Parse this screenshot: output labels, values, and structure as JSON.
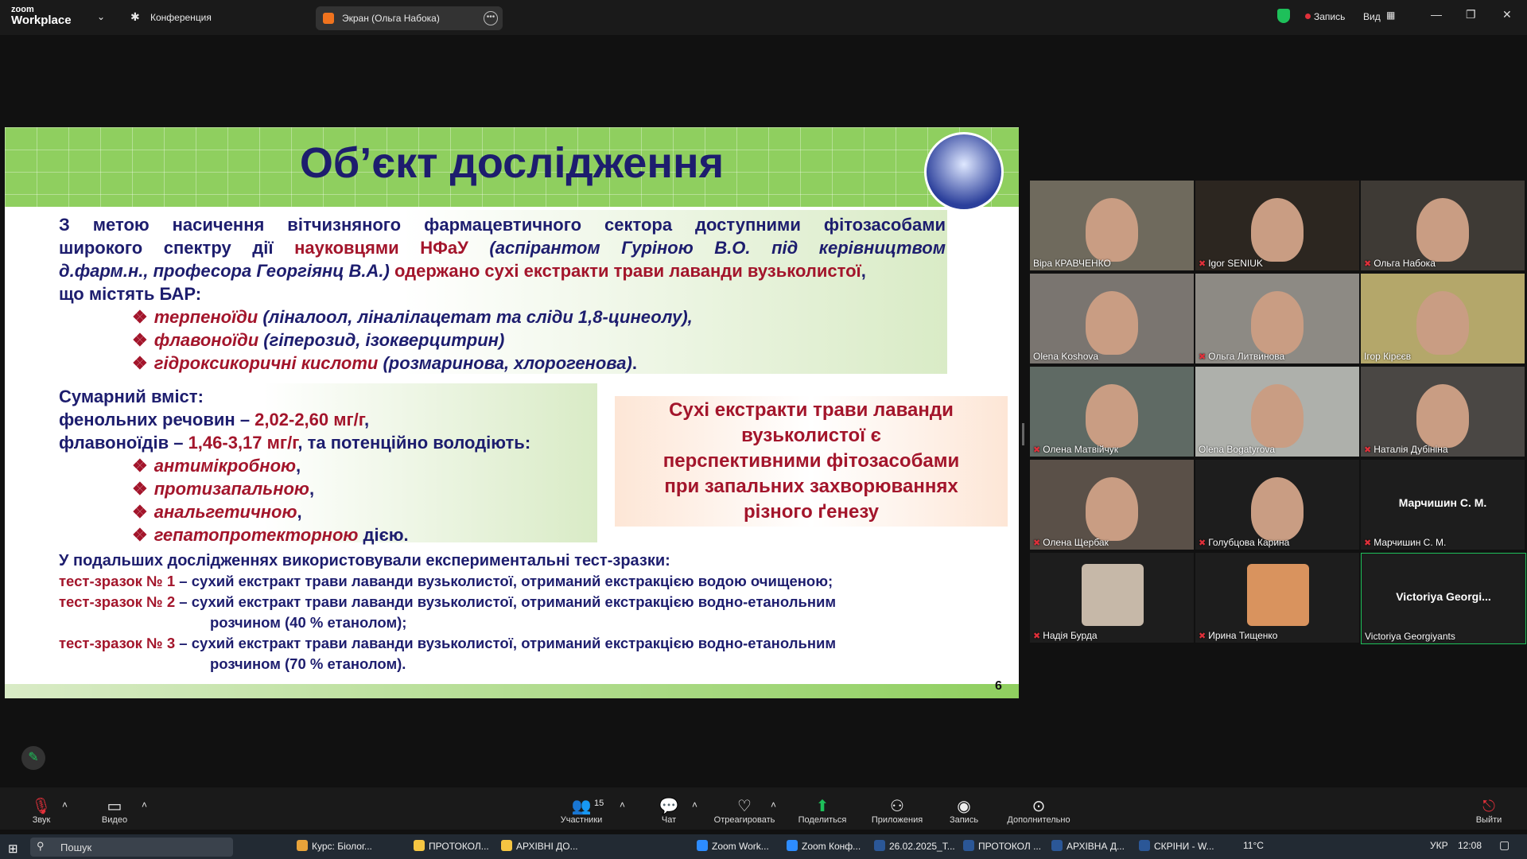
{
  "app": {
    "brand_line1": "zoom",
    "brand_line2": "Workplace",
    "conference": "Конференция",
    "sharing": "Экран (Ольга Набока)",
    "record_status": "Запись",
    "view": "Вид"
  },
  "slide": {
    "title": "Об’єкт дослідження",
    "p1_a": "З метою насичення вітчизняного фармацевтичного сектора доступними фітозасобами",
    "p1_b1": "широкого спектру дії ",
    "p1_b2": "науковцями НФаУ",
    "p1_b3": " (аспірантом Гуріною В.О. під керівництвом",
    "p1_c1": "д.фарм.н., професора Георгіянц В.А.)",
    "p1_c2": " одержано сухі екстракти трави лаванди вузьколистої",
    "p1_c3": ",",
    "p1_d": "що містять БАР:",
    "b1_a": "терпеноїди",
    "b1_b": " (ліналоол, ліналілацетат та сліди 1,8-цинеолу),",
    "b2_a": "флавоноїди",
    "b2_b": " (гіперозид, ізокверцитрин)",
    "b3_a": "гідроксикоричні кислоти",
    "b3_b": " (розмаринова, хлорогенова)",
    "b3_c": ".",
    "s_title": "Сумарний вміст:",
    "s1_a": "фенольних речовин – ",
    "s1_b": "2,02-2,60 мг/г",
    "s1_c": ",",
    "s2_a": "флавоноїдів – ",
    "s2_b": "1,46-3,17 мг/г",
    "s2_c": ", та потенційно володіють:",
    "a1": "антимікробною",
    "a1_c": ",",
    "a2": "протизапальною",
    "a2_c": ",",
    "a3": "анальгетичною",
    "a3_c": ",",
    "a4": "гепатопротекторною",
    "a4_c": " дією.",
    "concl_1": "Сухі екстракти трави лаванди",
    "concl_2": "вузьколистої є",
    "concl_3": "перспективними фітозасобами",
    "concl_4": "при запальних захворюваннях",
    "concl_5": "різного ґенезу",
    "l_title": "У подальших дослідженнях використовували експериментальні тест-зразки:",
    "t1_a": "тест-зразок № 1",
    "t1_b": " – сухий екстракт трави лаванди вузьколистої, отриманий екстракцією водою очищеною;",
    "t2_a": "тест-зразок № 2",
    "t2_b": " – сухий екстракт трави лаванди вузьколистої, отриманий екстракцією водно-етанольним",
    "t2_c": "розчином (40 % етанолом);",
    "t3_a": "тест-зразок № 3",
    "t3_b": " – сухий екстракт трави лаванди вузьколистої, отриманий екстракцією водно-етанольним",
    "t3_c": "розчином (70 % етанолом).",
    "page": "6"
  },
  "participants": [
    {
      "name": "Віра КРАВЧЕНКО",
      "muted": false
    },
    {
      "name": "Igor SENIUK",
      "muted": true
    },
    {
      "name": "Ольга Набока",
      "muted": true
    },
    {
      "name": "Olena Koshova",
      "muted": false
    },
    {
      "name": "Ольга Литвинова",
      "muted": true
    },
    {
      "name": "Ігор Кірєєв",
      "muted": false
    },
    {
      "name": "Олена Матвійчук",
      "muted": true
    },
    {
      "name": "Olena Bogatyrova",
      "muted": false
    },
    {
      "name": "Наталія Дубініна",
      "muted": true
    },
    {
      "name": "Олена Щербак",
      "muted": true
    },
    {
      "name": "Голубцова Карина",
      "muted": true
    },
    {
      "name": "Марчишин С. М.",
      "muted": true,
      "big": "Марчишин С. М."
    },
    {
      "name": "Надія Бурда",
      "muted": true
    },
    {
      "name": "Ирина Тищенко",
      "muted": true
    },
    {
      "name": "Victoriya Georgiyants",
      "muted": false,
      "big": "Victoriya  Georgi..."
    }
  ],
  "toolbar": {
    "audio": "Звук",
    "video": "Видео",
    "participants": "Участники",
    "participants_count": "15",
    "chat": "Чат",
    "react": "Отреагировать",
    "share": "Поделиться",
    "apps": "Приложения",
    "record": "Запись",
    "more": "Дополнительно",
    "leave": "Выйти"
  },
  "taskbar": {
    "search": "Пошук",
    "items": [
      "Курс: Біолог...",
      "ПРОТОКОЛ...",
      "АРХІВНІ ДО...",
      "Zoom Work...",
      "Zoom Конф...",
      "26.02.2025_Т...",
      "ПРОТОКОЛ ...",
      "АРХІВНА Д...",
      "СКРІНИ - W..."
    ],
    "weather": "11°C",
    "lang": "УКР",
    "time": "12:08"
  },
  "colors": {
    "accent_green": "#1ec05a",
    "title_blue": "#1d1d6e",
    "accent_red": "#a3152b"
  }
}
